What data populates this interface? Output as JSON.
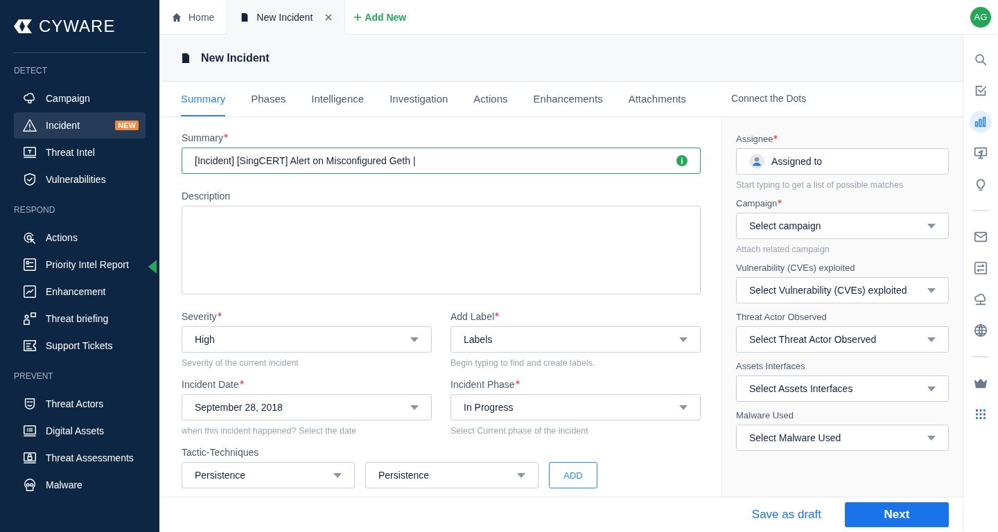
{
  "brand": {
    "name": "CYWARE"
  },
  "sidebar": {
    "sections": [
      {
        "title": "DETECT",
        "items": [
          {
            "label": "Campaign",
            "selected": false
          },
          {
            "label": "Incident",
            "selected": true,
            "badge": "NEW"
          },
          {
            "label": "Threat Intel",
            "selected": false
          },
          {
            "label": "Vulnerabilities",
            "selected": false
          }
        ]
      },
      {
        "title": "RESPOND",
        "items": [
          {
            "label": "Actions",
            "selected": false
          },
          {
            "label": "Priority Intel Report",
            "selected": false
          },
          {
            "label": "Enhancement",
            "selected": false
          },
          {
            "label": "Threat briefing",
            "selected": false
          },
          {
            "label": "Support Tickets",
            "selected": false
          }
        ]
      },
      {
        "title": "PREVENT",
        "items": [
          {
            "label": "Threat Actors",
            "selected": false
          },
          {
            "label": "Digital Assets",
            "selected": false
          },
          {
            "label": "Threat Assessments",
            "selected": false
          },
          {
            "label": "Malware",
            "selected": false
          }
        ]
      }
    ]
  },
  "top_tabs": [
    {
      "label": "Home",
      "selected": false,
      "closable": false
    },
    {
      "label": "New Incident",
      "selected": true,
      "closable": true
    }
  ],
  "add_tab": {
    "label": "Add New"
  },
  "user": {
    "initials": "AG"
  },
  "page_title": "New Incident",
  "tabs": [
    {
      "label": "Summary",
      "selected": true
    },
    {
      "label": "Phases",
      "selected": false
    },
    {
      "label": "Intelligence",
      "selected": false
    },
    {
      "label": "Investigation",
      "selected": false
    },
    {
      "label": "Actions",
      "selected": false
    },
    {
      "label": "Enhancements",
      "selected": false
    },
    {
      "label": "Attachments",
      "selected": false
    },
    {
      "label": "Connect the Dots",
      "selected": false
    }
  ],
  "form": {
    "summary": {
      "label": "Summary",
      "required": true,
      "value": "[Incident] [SingCERT] Alert on Misconfigured Geth |"
    },
    "description": {
      "label": "Description"
    },
    "pairs": [
      [
        {
          "label": "Severity",
          "required": true,
          "value": "High",
          "hint": "Severity of the current incident"
        },
        {
          "label": "Add Label",
          "required": true,
          "value": "Labels",
          "hint": "Begin typing to find and create labels."
        }
      ],
      [
        {
          "label": "Incident Date",
          "required": true,
          "value": "September 28, 2018",
          "hint": "when this incident happened? Select the date"
        },
        {
          "label": "Incident Phase",
          "required": true,
          "value": "In Progress",
          "hint": "Select Current phase of the incident"
        }
      ]
    ],
    "tactics": {
      "label": "Tactic-Techniques",
      "selects": [
        "Persistence",
        "Persistence"
      ],
      "button": "ADD"
    }
  },
  "side_fields": [
    {
      "kind": "person",
      "label": "Assignee",
      "required": true,
      "value": "Assigned to",
      "hint": "Start typing to get a list of possible matches"
    },
    {
      "kind": "select",
      "label": "Campaign",
      "required": true,
      "value": "Select campaign",
      "hint": "Attach related campaign"
    },
    {
      "kind": "select",
      "label": "Vulnerability (CVEs) exploited",
      "required": false,
      "value": "Select Vulnerability (CVEs) exploited"
    },
    {
      "kind": "select",
      "label": "Threat Actor Observed",
      "required": false,
      "value": "Select Threat Actor Observed"
    },
    {
      "kind": "select",
      "label": "Assets Interfaces",
      "required": false,
      "value": "Select Assets Interfaces"
    },
    {
      "kind": "select",
      "label": "Malware Used",
      "required": false,
      "value": "Select Malware Used"
    }
  ],
  "rail_icons": [
    {
      "selected": false
    },
    {
      "selected": false
    },
    {
      "selected": true
    },
    {
      "selected": false
    },
    {
      "selected": false
    },
    {
      "selected": false
    },
    {
      "selected": false
    },
    {
      "selected": false
    },
    {
      "selected": false
    },
    {
      "selected": false
    },
    {
      "selected": false
    }
  ],
  "footer": {
    "draft": "Save as draft",
    "next": "Next"
  }
}
